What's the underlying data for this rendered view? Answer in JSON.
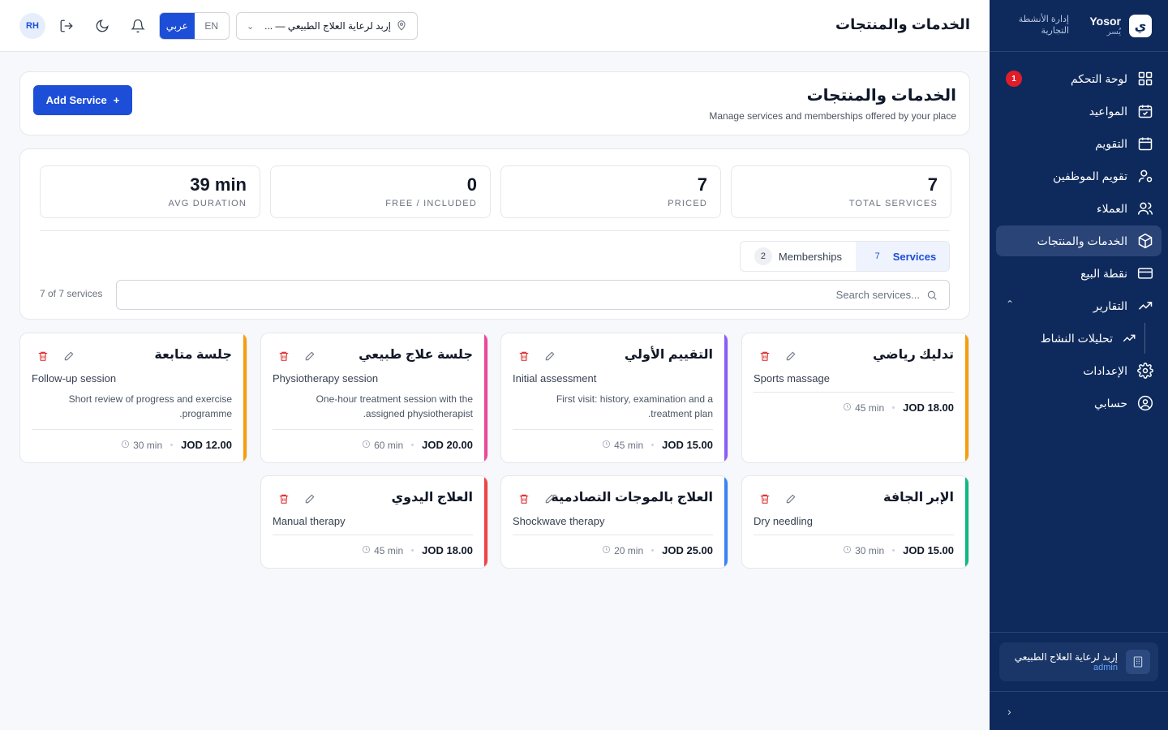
{
  "brand": {
    "name_en": "Yosor",
    "name_ar": "يُسر",
    "logo_letter": "ي",
    "subtitle": "إدارة الأنشطة التجارية"
  },
  "sidebar": {
    "items": [
      {
        "label": "لوحة التحكم",
        "icon": "dashboard-icon",
        "badge": "1"
      },
      {
        "label": "المواعيد",
        "icon": "calendar-check-icon"
      },
      {
        "label": "التقويم",
        "icon": "calendar-icon"
      },
      {
        "label": "تقويم الموظفين",
        "icon": "user-cog-icon"
      },
      {
        "label": "العملاء",
        "icon": "users-icon"
      },
      {
        "label": "الخدمات والمنتجات",
        "icon": "package-icon",
        "active": true
      },
      {
        "label": "نقطة البيع",
        "icon": "credit-card-icon"
      },
      {
        "label": "التقارير",
        "icon": "trending-up-icon"
      },
      {
        "label": "تحليلات النشاط",
        "icon": "trending-up-icon"
      },
      {
        "label": "الإعدادات",
        "icon": "settings-icon"
      },
      {
        "label": "حسابي",
        "icon": "user-circle-icon"
      }
    ],
    "user": {
      "place": "إربد لرعاية العلاج الطبيعي",
      "role": "admin"
    },
    "collapse": "›"
  },
  "topbar": {
    "title": "الخدمات والمنتجات",
    "avatar": "RH",
    "lang_en": "EN",
    "lang_ar": "عربي",
    "location": "إربد لرعاية العلاج الطبيعي — ..."
  },
  "header": {
    "title": "الخدمات والمنتجات",
    "subtitle": "Manage services and memberships offered by your place",
    "add_button": "Add Service"
  },
  "stats": [
    {
      "value": "39 min",
      "label": "AVG DURATION"
    },
    {
      "value": "0",
      "label": "FREE / INCLUDED"
    },
    {
      "value": "7",
      "label": "PRICED"
    },
    {
      "value": "7",
      "label": "TOTAL SERVICES"
    }
  ],
  "tabs": {
    "services": {
      "label": "Services",
      "count": "7"
    },
    "memberships": {
      "label": "Memberships",
      "count": "2"
    }
  },
  "search": {
    "placeholder": "Search services...",
    "count_label": "7 of 7 services"
  },
  "services": [
    {
      "title_ar": "جلسة متابعة",
      "title_en": "Follow-up session",
      "desc": "Short review of progress and exercise programme.",
      "price": "JOD 12.00",
      "duration": "30 min",
      "color": "#f59e0b"
    },
    {
      "title_ar": "جلسة علاج طبيعي",
      "title_en": "Physiotherapy session",
      "desc": "One-hour treatment session with the assigned physiotherapist.",
      "price": "JOD 20.00",
      "duration": "60 min",
      "color": "#ec4899"
    },
    {
      "title_ar": "التقييم الأولي",
      "title_en": "Initial assessment",
      "desc": "First visit: history, examination and a treatment plan.",
      "price": "JOD 15.00",
      "duration": "45 min",
      "color": "#8b5cf6"
    },
    {
      "title_ar": "تدليك رياضي",
      "title_en": "Sports massage",
      "desc": "",
      "price": "JOD 18.00",
      "duration": "45 min",
      "color": "#f59e0b"
    },
    {
      "title_ar": "العلاج اليدوي",
      "title_en": "Manual therapy",
      "desc": "",
      "price": "JOD 18.00",
      "duration": "45 min",
      "color": "#ef4444"
    },
    {
      "title_ar": "العلاج بالموجات التصادمية",
      "title_en": "Shockwave therapy",
      "desc": "",
      "price": "JOD 25.00",
      "duration": "20 min",
      "color": "#3b82f6"
    },
    {
      "title_ar": "الإبر الجافة",
      "title_en": "Dry needling",
      "desc": "",
      "price": "JOD 15.00",
      "duration": "30 min",
      "color": "#10b981"
    }
  ]
}
